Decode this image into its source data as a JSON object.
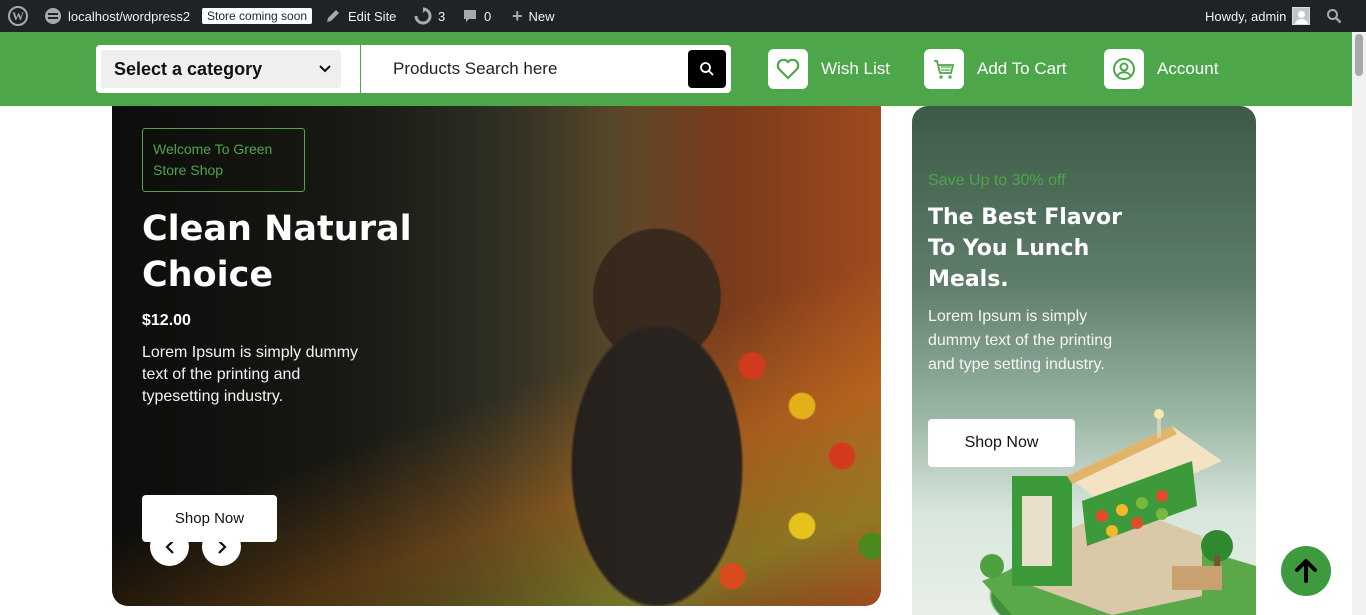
{
  "admin_bar": {
    "site_url": "localhost/wordpress2",
    "store_badge": "Store coming soon",
    "edit_site": "Edit Site",
    "updates_count": "3",
    "comments_count": "0",
    "new_label": "New",
    "howdy": "Howdy, admin"
  },
  "header": {
    "category_select": "Select a category",
    "search_placeholder": "Products Search here",
    "wishlist": "Wish List",
    "cart": "Add To Cart",
    "account": "Account"
  },
  "hero": {
    "welcome": "Welcome To Green Store Shop",
    "title": "Clean Natural Choice",
    "price": "$12.00",
    "description": "Lorem Ipsum is simply dummy text of the printing and typesetting industry.",
    "button": "Shop Now"
  },
  "promo": {
    "kicker": "Save Up to 30% off",
    "title": "The Best Flavor To You Lunch Meals.",
    "description": "Lorem Ipsum is simply dummy text of the printing and type setting industry.",
    "button": "Shop Now"
  },
  "colors": {
    "brand_green": "#4da64a",
    "admin_bar": "#1d2327",
    "back_to_top": "#3f9a3f"
  }
}
